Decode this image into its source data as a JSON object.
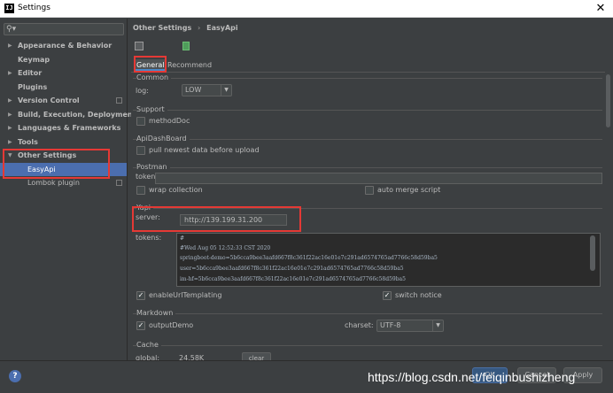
{
  "window": {
    "logo": "IJ",
    "title": "Settings",
    "close": "✕"
  },
  "search": {
    "icon": "⚲▾",
    "placeholder": ""
  },
  "nav": {
    "items": [
      {
        "arrow": "▶",
        "label": "Appearance & Behavior",
        "has_project_icon": false
      },
      {
        "arrow": "",
        "label": "Keymap",
        "has_project_icon": false
      },
      {
        "arrow": "▶",
        "label": "Editor",
        "has_project_icon": false
      },
      {
        "arrow": "",
        "label": "Plugins",
        "has_project_icon": false
      },
      {
        "arrow": "▶",
        "label": "Version Control",
        "has_project_icon": true
      },
      {
        "arrow": "▶",
        "label": "Build, Execution, Deployment",
        "has_project_icon": false
      },
      {
        "arrow": "▶",
        "label": "Languages & Frameworks",
        "has_project_icon": false
      },
      {
        "arrow": "▶",
        "label": "Tools",
        "has_project_icon": false
      },
      {
        "arrow": "▼",
        "label": "Other Settings",
        "has_project_icon": false
      },
      {
        "arrow": "",
        "label": "EasyApi",
        "has_project_icon": false,
        "selected": true
      },
      {
        "arrow": "",
        "label": "Lombok plugin",
        "has_project_icon": true
      }
    ]
  },
  "breadcrumb": {
    "parent": "Other Settings",
    "separator": "›",
    "current": "EasyApi"
  },
  "tabs": [
    {
      "label": "General",
      "active": true
    },
    {
      "label": "Recommend",
      "active": false
    }
  ],
  "common": {
    "title": "Common",
    "log_label": "log:",
    "log_value": "LOW"
  },
  "support": {
    "title": "Support",
    "methoddoc_label": "methodDoc",
    "methoddoc_checked": false
  },
  "apidashboard": {
    "title": "ApiDashBoard",
    "pull_label": "pull newest data before upload",
    "pull_checked": false
  },
  "postman": {
    "title": "Postman",
    "token_label": "token:",
    "token_value": "",
    "wrap_label": "wrap collection",
    "wrap_checked": false,
    "merge_label": "auto merge script",
    "merge_checked": false
  },
  "yapi": {
    "title": "Yapi",
    "server_label": "server:",
    "server_value": "http://139.199.31.200",
    "tokens_label": "tokens:",
    "tokens_lines": [
      "#",
      "#Wed Aug 05 12:52:33 CST 2020",
      "springboot-demo=5b6cca9bee3aafd667f8c361f22ac16e01e7c291ad6574765ad7766c58d59ba5",
      "user=5b6cca9bee3aafd667f8c361f22ac16e01e7c291ad6574765ad7766c58d59ba5",
      "im-hf=5b6cca9bee3aafd667f8c361f22ac16e01e7c291ad6574765ad7766c58d59ba5"
    ],
    "url_templating_label": "enableUrlTemplating",
    "url_templating_checked": true,
    "switch_notice_label": "switch notice",
    "switch_notice_checked": true
  },
  "markdown": {
    "title": "Markdown",
    "output_label": "outputDemo",
    "output_checked": true,
    "charset_label": "charset:",
    "charset_value": "UTF-8"
  },
  "cache": {
    "title": "Cache",
    "global_label": "global:",
    "global_value": "24.58K",
    "clear_label": "clear"
  },
  "footer": {
    "help": "?",
    "ok_label": "OK",
    "cancel_label": "Cancel",
    "apply_label": "Apply"
  },
  "watermark": "https://blog.csdn.net/feiqinbushizheng",
  "check_glyph": "✓",
  "colors": {
    "accent": "#4b6eaf",
    "annotation": "#e53935",
    "background": "#3c3f41"
  }
}
